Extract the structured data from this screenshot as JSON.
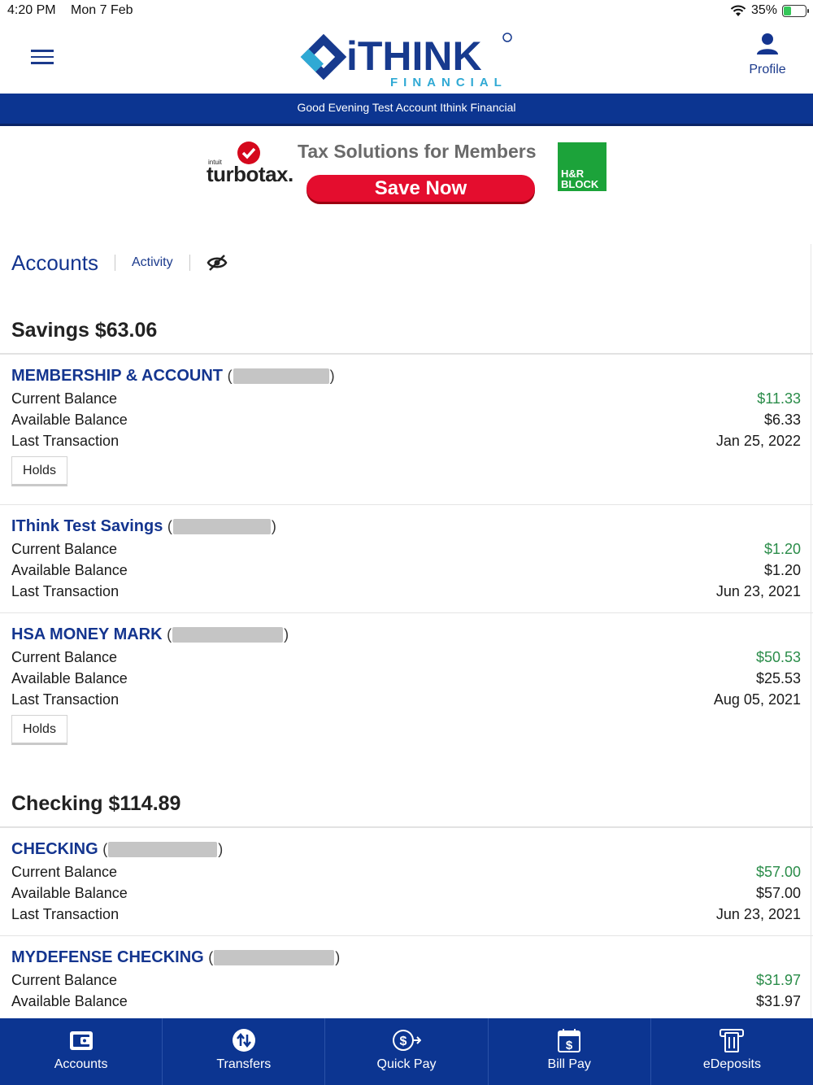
{
  "status": {
    "time": "4:20 PM",
    "date": "Mon 7 Feb",
    "battery": "35%"
  },
  "header": {
    "logo_main": "iTHINK",
    "logo_sub": "FINANCIAL",
    "profile_label": "Profile"
  },
  "greeting": "Good Evening Test Account Ithink Financial",
  "ad": {
    "intuit": "intuit",
    "turbotax": "turbotax.",
    "headline": "Tax Solutions for Members",
    "cta": "Save Now",
    "hr1": "H&R",
    "hr2": "BLOCK"
  },
  "tabs": {
    "accounts": "Accounts",
    "activity": "Activity"
  },
  "labels": {
    "current": "Current Balance",
    "available": "Available Balance",
    "last": "Last Transaction",
    "holds": "Holds"
  },
  "savings": {
    "title": "Savings $63.06",
    "accounts": [
      {
        "name": "MEMBERSHIP & ACCOUNT",
        "current": "$11.33",
        "available": "$6.33",
        "last": "Jan 25, 2022"
      },
      {
        "name": "IThink Test Savings",
        "current": "$1.20",
        "available": "$1.20",
        "last": "Jun 23, 2021"
      },
      {
        "name": "HSA MONEY MARK",
        "current": "$50.53",
        "available": "$25.53",
        "last": "Aug 05, 2021"
      }
    ]
  },
  "checking": {
    "title": "Checking $114.89",
    "accounts": [
      {
        "name": "CHECKING",
        "current": "$57.00",
        "available": "$57.00",
        "last": "Jun 23, 2021"
      },
      {
        "name": "MYDEFENSE CHECKING",
        "current": "$31.97",
        "available": "$31.97"
      }
    ]
  },
  "nav": [
    "Accounts",
    "Transfers",
    "Quick Pay",
    "Bill Pay",
    "eDeposits"
  ]
}
